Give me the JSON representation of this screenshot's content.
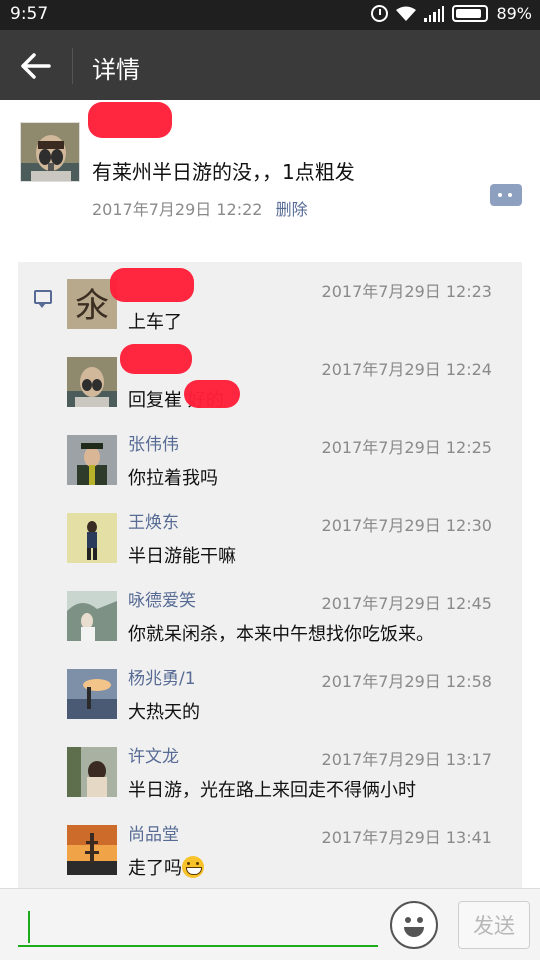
{
  "status_bar": {
    "time": "9:57",
    "battery": "89%",
    "battery_level": 0.89,
    "icons": [
      "alarm-icon",
      "wifi-icon",
      "signal-icon",
      "battery-icon"
    ]
  },
  "header": {
    "title": "详情",
    "back_icon": "arrow-left-icon"
  },
  "post": {
    "author": "",
    "content": "有莱州半日游的没，，1点粗发",
    "time": "2017年7月29日 12:22",
    "delete_label": "删除",
    "comment_icon": "comment-more-icon"
  },
  "comments": [
    {
      "name": "",
      "time": "2017年7月29日 12:23",
      "text": "上车了"
    },
    {
      "name": "",
      "time": "2017年7月29日 12:24",
      "text": "回复崔        好的"
    },
    {
      "name": "张伟伟",
      "time": "2017年7月29日 12:25",
      "text": "你拉着我吗"
    },
    {
      "name": "王焕东",
      "time": "2017年7月29日 12:30",
      "text": "半日游能干嘛"
    },
    {
      "name": "咏德爱笑",
      "time": "2017年7月29日 12:45",
      "text": "你就呆闲杀，本来中午想找你吃饭来。"
    },
    {
      "name": "杨兆勇/1",
      "time": "2017年7月29日 12:58",
      "text": "大热天的"
    },
    {
      "name": "许文龙",
      "time": "2017年7月29日 13:17",
      "text": "半日游，光在路上来回走不得俩小时"
    },
    {
      "name": "尚品堂",
      "time": "2017年7月29日 13:41",
      "text": "走了吗",
      "emoji": "grinning-face-icon"
    }
  ],
  "input_bar": {
    "placeholder": "",
    "send_label": "发送",
    "emoji_icon": "smiley-icon"
  },
  "colors": {
    "accent_green": "#1aad19",
    "link_blue": "#576b95",
    "title_bar": "#3a3a3a",
    "redaction": "#ff1f3a"
  }
}
